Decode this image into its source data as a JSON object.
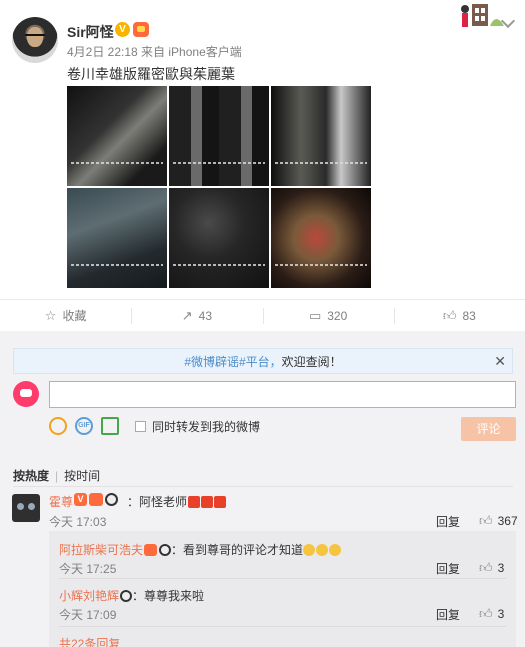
{
  "post": {
    "author": "Sir阿怪",
    "meta": "4月2日 22:18 来自 iPhone客户端",
    "caption": "卷川幸雄版羅密歐與茱麗葉"
  },
  "actions": {
    "favorite_label": "收藏",
    "repost_count": "43",
    "comment_count": "320",
    "like_count": "83"
  },
  "comments": {
    "notice_prefix": "#微博辟谣#平台，",
    "notice_link": "欢迎查阅！",
    "input_value": "",
    "sync_label": "同时转发到我的微博",
    "submit_label": "评论",
    "sort_hot": "按热度",
    "sort_time": "按时间",
    "items": [
      {
        "name": "霍尊",
        "text": "：阿怪老师",
        "time": "今天 17:03",
        "reply": "回复",
        "likes": "367"
      }
    ],
    "subs": [
      {
        "name": "阿拉斯柴可浩夫",
        "text": "：看到尊哥的评论才知道",
        "time": "今天 17:25",
        "reply": "回复",
        "likes": "3"
      },
      {
        "name": "小辉刘艳辉",
        "text": "：尊尊我来啦",
        "time": "今天 17:09",
        "reply": "回复",
        "likes": "3"
      }
    ],
    "more_replies": "共22条回复"
  }
}
